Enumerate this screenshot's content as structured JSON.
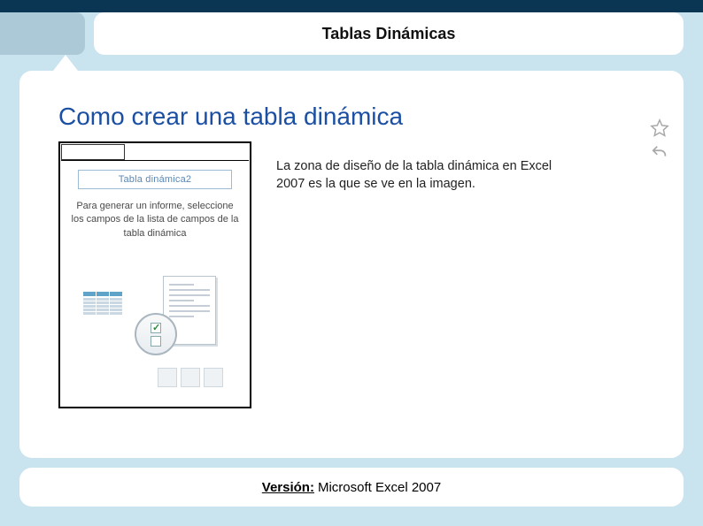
{
  "header": {
    "title": "Tablas Dinámicas"
  },
  "main": {
    "title": "Como crear una tabla dinámica",
    "description": "La zona de diseño de la tabla dinámica en Excel 2007 es la que se ve en la imagen."
  },
  "thumbnail": {
    "pivot_label": "Tabla dinámica2",
    "hint": "Para generar un informe, seleccione los campos de la lista de campos de la tabla dinámica"
  },
  "side": {
    "star_icon": "star-icon",
    "undo_icon": "undo-icon"
  },
  "footer": {
    "version_label": "Versión:",
    "version_value": "Microsoft Excel 2007"
  }
}
